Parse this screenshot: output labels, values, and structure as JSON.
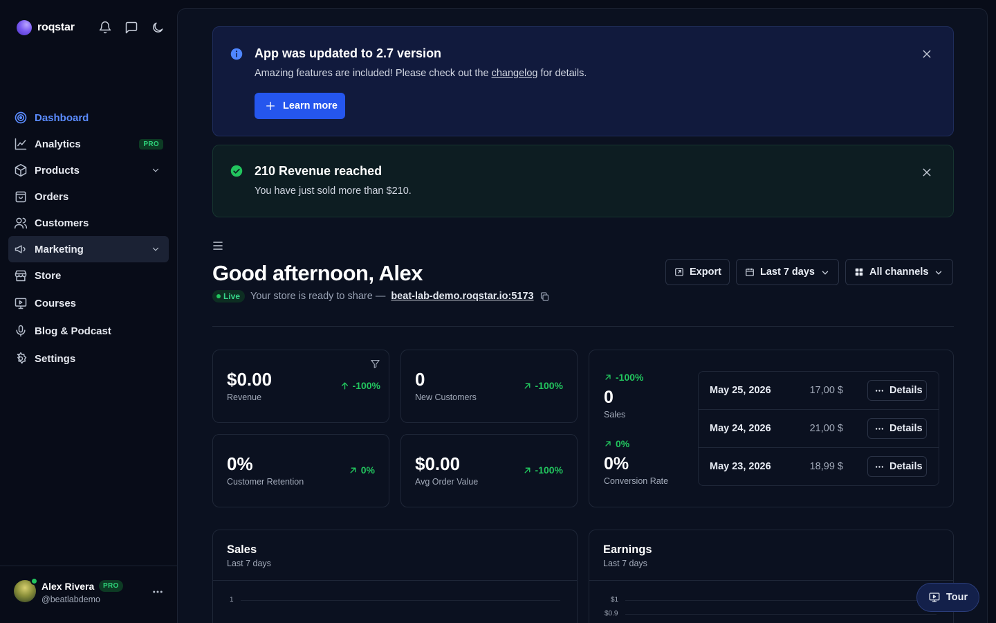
{
  "brand": {
    "name": "roqstar"
  },
  "sidebar": {
    "items": [
      {
        "label": "Dashboard"
      },
      {
        "label": "Analytics",
        "badge": "PRO"
      },
      {
        "label": "Products"
      },
      {
        "label": "Orders"
      },
      {
        "label": "Customers"
      },
      {
        "label": "Marketing"
      },
      {
        "label": "Store"
      },
      {
        "label": "Courses"
      },
      {
        "label": "Blog & Podcast"
      },
      {
        "label": "Settings"
      }
    ],
    "user": {
      "name": "Alex Rivera",
      "badge": "PRO",
      "handle": "@beatlabdemo"
    }
  },
  "alerts": {
    "info": {
      "title": "App was updated to 2.7 version",
      "text_before": "Amazing features are included! Please check out the ",
      "link": "changelog",
      "text_after": " for details.",
      "button": "Learn more"
    },
    "success": {
      "title": "210 Revenue reached",
      "text": "You have just sold more than $210."
    }
  },
  "header": {
    "greeting": "Good afternoon, Alex",
    "live_label": "Live",
    "share_text": "Your store is ready to share —",
    "store_url": "beat-lab-demo.roqstar.io:5173",
    "export_label": "Export",
    "range_label": "Last 7 days",
    "channels_label": "All channels"
  },
  "kpis": [
    {
      "value": "$0.00",
      "label": "Revenue",
      "change": "-100%"
    },
    {
      "value": "0",
      "label": "New Customers",
      "change": "-100%"
    },
    {
      "value": "0%",
      "label": "Customer Retention",
      "change": "0%"
    },
    {
      "value": "$0.00",
      "label": "Avg Order Value",
      "change": "-100%"
    }
  ],
  "mini_stats": [
    {
      "change": "-100%",
      "value": "0",
      "label": "Sales"
    },
    {
      "change": "0%",
      "value": "0%",
      "label": "Conversion Rate"
    }
  ],
  "transactions": [
    {
      "date": "May 25, 2026",
      "amount": "17,00 $",
      "action": "Details"
    },
    {
      "date": "May 24, 2026",
      "amount": "21,00 $",
      "action": "Details"
    },
    {
      "date": "May 23, 2026",
      "amount": "18,99 $",
      "action": "Details"
    }
  ],
  "charts": {
    "sales": {
      "title": "Sales",
      "subtitle": "Last 7 days",
      "ticks": [
        "1"
      ]
    },
    "earnings": {
      "title": "Earnings",
      "subtitle": "Last 7 days",
      "ticks": [
        "$1",
        "$0.9"
      ]
    }
  },
  "tour": {
    "label": "Tour"
  },
  "colors": {
    "accent": "#2556ee",
    "positive": "#22c55e",
    "active_nav": "#5b8cff"
  }
}
